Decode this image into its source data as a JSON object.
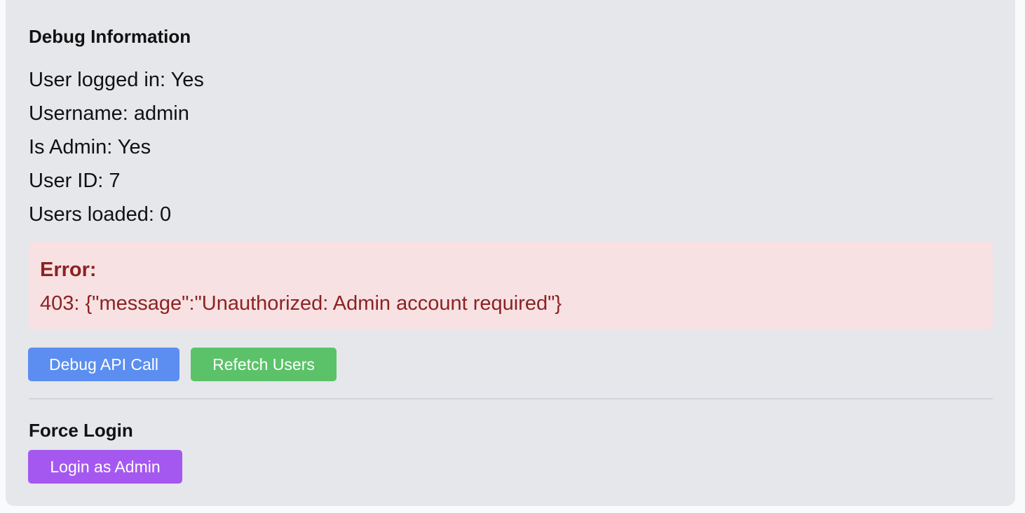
{
  "debug": {
    "title": "Debug Information",
    "lines": [
      "User logged in: Yes",
      "Username: admin",
      "Is Admin: Yes",
      "User ID: 7",
      "Users loaded: 0"
    ]
  },
  "error": {
    "label": "Error:",
    "message": "403: {\"message\":\"Unauthorized: Admin account required\"}"
  },
  "actions": {
    "debug_api_call": "Debug API Call",
    "refetch_users": "Refetch Users"
  },
  "force_login": {
    "title": "Force Login",
    "button": "Login as Admin"
  },
  "colors": {
    "panel_bg": "#e5e7eb",
    "error_bg": "#f8e1e2",
    "error_text": "#8b2323",
    "debug_button": "#5b8ef0",
    "refetch_button": "#5bc26a",
    "login_button": "#a558f0"
  }
}
